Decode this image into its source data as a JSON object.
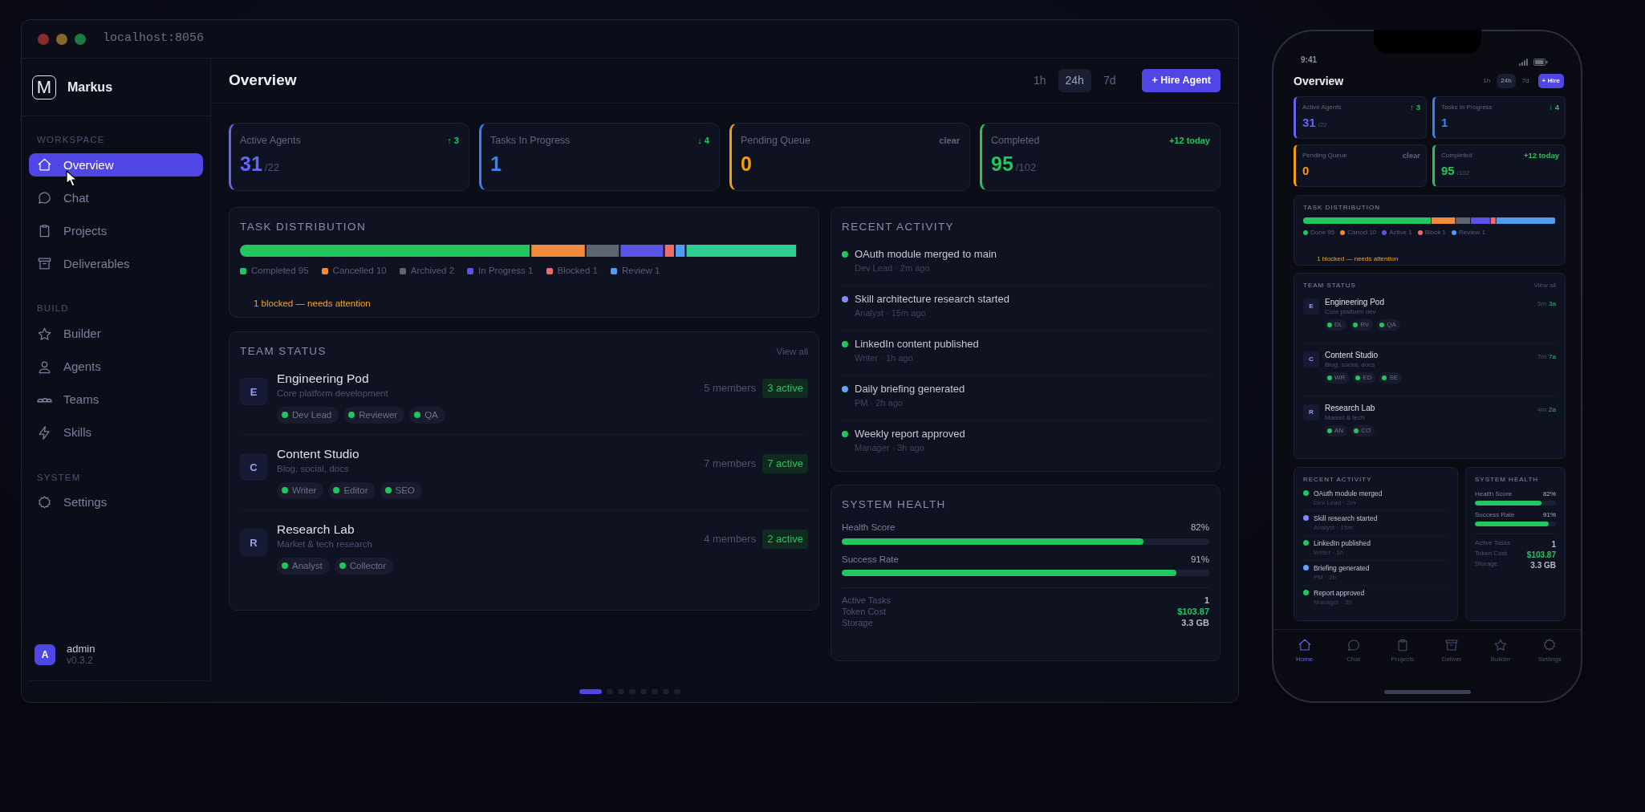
{
  "window": {
    "address": "localhost:8056"
  },
  "sidebar": {
    "logo": "M",
    "brand": "Markus",
    "sections": [
      {
        "heading": "WORKSPACE",
        "items": [
          {
            "label": "Overview",
            "selected": true
          },
          {
            "label": "Chat",
            "selected": false
          },
          {
            "label": "Projects",
            "selected": false
          },
          {
            "label": "Deliverables",
            "selected": false
          }
        ]
      },
      {
        "heading": "BUILD",
        "items": [
          {
            "label": "Builder",
            "selected": false
          },
          {
            "label": "Agents",
            "selected": false
          },
          {
            "label": "Teams",
            "selected": false
          },
          {
            "label": "Skills",
            "selected": false
          }
        ]
      },
      {
        "heading": "SYSTEM",
        "items": [
          {
            "label": "Settings",
            "selected": false
          }
        ]
      }
    ],
    "user": {
      "avatar": "A",
      "name": "admin",
      "version": "v0.3.2"
    }
  },
  "header": {
    "title": "Overview",
    "ranges": [
      {
        "label": "1h",
        "selected": false
      },
      {
        "label": "24h",
        "selected": true
      },
      {
        "label": "7d",
        "selected": false
      }
    ],
    "action": "+ Hire Agent"
  },
  "stats": [
    {
      "label": "Active Agents",
      "value": "31",
      "total": "/22",
      "delta": {
        "text": "↑ 3",
        "color": "#22c55e"
      },
      "color": "#6366f1"
    },
    {
      "label": "Tasks In Progress",
      "value": "1",
      "delta": {
        "text": "↓ 4",
        "color": "#22c55e"
      },
      "color": "#3b82f6"
    },
    {
      "label": "Pending Queue",
      "value": "0",
      "delta": {
        "text": "clear",
        "color": "#5f6580"
      },
      "color": "#f59e0b"
    },
    {
      "label": "Completed",
      "value": "95",
      "total": "/102",
      "delta": {
        "text": "+12 today",
        "color": "#22c55e"
      },
      "color": "#22c55e"
    }
  ],
  "task_distribution": {
    "title": "TASK DISTRIBUTION",
    "legend": [
      {
        "label": "Completed 95",
        "color": "#22c55e"
      },
      {
        "label": "Cancelled 10",
        "color": "#f28a3c"
      },
      {
        "label": "Archived 2",
        "color": "#5f6472"
      },
      {
        "label": "In Progress 1",
        "color": "#5b55e6"
      },
      {
        "label": "Blocked 1",
        "color": "#f26b6b"
      },
      {
        "label": "Review 1",
        "color": "#4f9cf5"
      }
    ],
    "alert": "1 blocked — needs attention"
  },
  "team_status": {
    "title": "TEAM STATUS",
    "link": "View all",
    "teams": [
      {
        "initial": "E",
        "name": "Engineering Pod",
        "description": "Core platform development",
        "members": "5 members",
        "active": "3 active",
        "roles": [
          "Dev Lead",
          "Reviewer",
          "QA"
        ]
      },
      {
        "initial": "C",
        "name": "Content Studio",
        "description": "Blog, social, docs",
        "members": "7 members",
        "active": "7 active",
        "roles": [
          "Writer",
          "Editor",
          "SEO"
        ]
      },
      {
        "initial": "R",
        "name": "Research Lab",
        "description": "Market & tech research",
        "members": "4 members",
        "active": "2 active",
        "roles": [
          "Analyst",
          "Collector"
        ]
      }
    ]
  },
  "recent_activity": {
    "title": "RECENT ACTIVITY",
    "events": [
      {
        "text": "OAuth module merged to main",
        "meta": "Dev Lead · 2m ago",
        "color": "#22c55e"
      },
      {
        "text": "Skill architecture research started",
        "meta": "Analyst · 15m ago",
        "color": "#818cf8"
      },
      {
        "text": "LinkedIn content published",
        "meta": "Writer · 1h ago",
        "color": "#22c55e"
      },
      {
        "text": "Daily briefing generated",
        "meta": "PM · 2h ago",
        "color": "#60a5fa"
      },
      {
        "text": "Weekly report approved",
        "meta": "Manager · 3h ago",
        "color": "#22c55e"
      }
    ]
  },
  "system_health": {
    "title": "SYSTEM HEALTH",
    "meters": [
      {
        "label": "Health Score",
        "reading": "82%",
        "level": 0.82
      },
      {
        "label": "Success Rate",
        "reading": "91%",
        "level": 0.91
      }
    ],
    "stats": [
      {
        "label": "Active Tasks",
        "value": "1",
        "color": "#b4b8c8"
      },
      {
        "label": "Token Cost",
        "value": "$103.87",
        "color": "#22c55e"
      },
      {
        "label": "Storage",
        "value": "3.3 GB",
        "color": "#b4b8c8"
      }
    ]
  },
  "pager": [
    {
      "selected": true
    },
    {
      "selected": false
    },
    {
      "selected": false
    },
    {
      "selected": false
    },
    {
      "selected": false
    },
    {
      "selected": false
    },
    {
      "selected": false
    },
    {
      "selected": false
    }
  ],
  "phone": {
    "time": "9:41",
    "header": {
      "title": "Overview",
      "ranges": [
        {
          "label": "1h",
          "selected": false
        },
        {
          "label": "24h",
          "selected": true
        },
        {
          "label": "7d",
          "selected": false
        }
      ],
      "action": "+ Hire"
    },
    "stats": [
      {
        "label": "Active Agents",
        "value": "31",
        "total": "/22",
        "delta": {
          "text": "↑ 3",
          "color": "#22c55e"
        },
        "color": "#6366f1"
      },
      {
        "label": "Tasks In Progress",
        "value": "1",
        "delta": {
          "text": "↓ 4",
          "color": "#22c55e"
        },
        "color": "#3b82f6"
      },
      {
        "label": "Pending Queue",
        "value": "0",
        "delta": {
          "text": "clear",
          "color": "#5f6580"
        },
        "color": "#f59e0b"
      },
      {
        "label": "Completed",
        "value": "95",
        "total": "/102",
        "delta": {
          "text": "+12 today",
          "color": "#22c55e"
        },
        "color": "#22c55e"
      }
    ],
    "task_distribution": {
      "title": "TASK DISTRIBUTION",
      "legend": [
        {
          "label": "Done 95",
          "color": "#22c55e"
        },
        {
          "label": "Cancel 10",
          "color": "#f28a3c"
        },
        {
          "label": "Active 1",
          "color": "#5b55e6"
        },
        {
          "label": "Block 1",
          "color": "#f26b6b"
        },
        {
          "label": "Review 1",
          "color": "#4f9cf5"
        }
      ],
      "alert": "1 blocked — needs attention"
    },
    "team_status": {
      "title": "TEAM STATUS",
      "link": "View all",
      "teams": [
        {
          "initial": "E",
          "name": "Engineering Pod",
          "description": "Core platform dev",
          "members": "5m",
          "active": "3a",
          "roles": [
            "DL",
            "RV",
            "QA"
          ]
        },
        {
          "initial": "C",
          "name": "Content Studio",
          "description": "Blog, social, docs",
          "members": "7m",
          "active": "7a",
          "roles": [
            "WR",
            "ED",
            "SE"
          ]
        },
        {
          "initial": "R",
          "name": "Research Lab",
          "description": "Market & tech",
          "members": "4m",
          "active": "2a",
          "roles": [
            "AN",
            "CO"
          ]
        }
      ]
    },
    "recent_activity": {
      "title": "RECENT ACTIVITY",
      "events": [
        {
          "text": "OAuth module merged",
          "meta": "Dev Lead · 2m",
          "color": "#22c55e"
        },
        {
          "text": "Skill research started",
          "meta": "Analyst · 15m",
          "color": "#818cf8"
        },
        {
          "text": "LinkedIn published",
          "meta": "Writer · 1h",
          "color": "#22c55e"
        },
        {
          "text": "Briefing generated",
          "meta": "PM · 2h",
          "color": "#60a5fa"
        },
        {
          "text": "Report approved",
          "meta": "Manager · 3h",
          "color": "#22c55e"
        }
      ]
    },
    "system_health": {
      "title": "SYSTEM HEALTH",
      "meters": [
        {
          "label": "Health Score",
          "reading": "82%",
          "level": 0.82
        },
        {
          "label": "Success Rate",
          "reading": "91%",
          "level": 0.91
        }
      ],
      "stats": [
        {
          "label": "Active Tasks",
          "value": "1",
          "color": "#b4b8c8"
        },
        {
          "label": "Token Cost",
          "value": "$103.87",
          "color": "#22c55e"
        },
        {
          "label": "Storage",
          "value": "3.3 GB",
          "color": "#b4b8c8"
        }
      ]
    },
    "tab_bar": [
      {
        "label": "Home",
        "selected": true
      },
      {
        "label": "Chat",
        "selected": false
      },
      {
        "label": "Projects",
        "selected": false
      },
      {
        "label": "Deliver",
        "selected": false
      },
      {
        "label": "Builder",
        "selected": false
      },
      {
        "label": "Settings",
        "selected": false
      }
    ]
  }
}
